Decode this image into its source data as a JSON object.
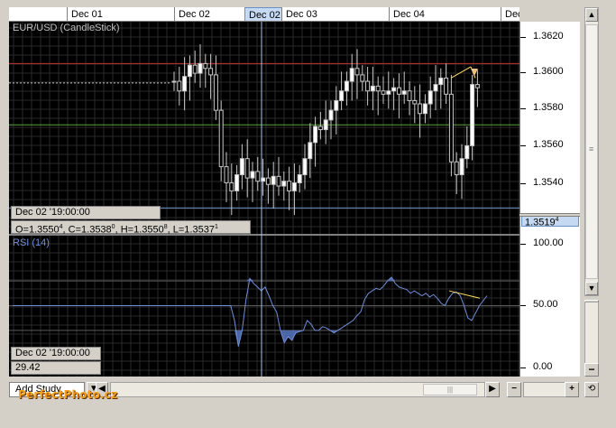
{
  "date_axis": {
    "labels": [
      {
        "text": "Dec 01",
        "selected": false
      },
      {
        "text": "Dec 02",
        "selected": false
      },
      {
        "text": "Dec 02",
        "selected": true
      },
      {
        "text": "Dec 03",
        "selected": false
      },
      {
        "text": "Dec 04",
        "selected": false
      },
      {
        "text": "Dec",
        "selected": false
      }
    ]
  },
  "price_pane": {
    "title": "EUR/USD (CandleStick)",
    "axis_labels": [
      "1.3620",
      "1.3600",
      "1.3580",
      "1.3560",
      "1.3540"
    ],
    "current_price": "1.3519",
    "current_price_sup": "4",
    "hover_time": "Dec 02 '19:00:00",
    "ohlc": {
      "o": "O=1.3550",
      "o_sup": "4",
      "c": "C=1.3538",
      "c_sup": "0",
      "h": "H=1.3550",
      "h_sup": "8",
      "l": "L=1.3537",
      "l_sup": "1"
    }
  },
  "rsi_pane": {
    "title": "RSI (14)",
    "axis_labels": [
      "100.00",
      "50.00",
      "0.00"
    ],
    "hover_time": "Dec 02 '19:00:00",
    "value": "29.42"
  },
  "bottom_bar": {
    "add_study_label": "Add Study",
    "zoom_minus": "−",
    "zoom_plus": "+",
    "refresh": "⟲"
  },
  "watermark": "PerfectPhoto.cz",
  "colors": {
    "chart_bg": "#000000",
    "grid": "#2a2a2a",
    "candle": "#c8c8c8",
    "resistance": "#c03030",
    "support": "#5aa03a",
    "rsi_line": "#6f8fdc",
    "crosshair": "#a0c8f0",
    "trendline": "#ffe060"
  },
  "chart_data": [
    {
      "type": "candlestick",
      "title": "EUR/USD (CandleStick)",
      "ylim": [
        1.3505,
        1.3635
      ],
      "ticks": [
        1.362,
        1.36,
        1.358,
        1.356,
        1.354
      ],
      "levels": {
        "resistance": 1.3609,
        "support": 1.3571,
        "current": 1.35194
      },
      "close_path": [
        1.3598,
        1.3592,
        1.3601,
        1.3608,
        1.3603,
        1.3609,
        1.3606,
        1.3602,
        1.358,
        1.3545,
        1.3535,
        1.353,
        1.354,
        1.355,
        1.3538,
        1.3542,
        1.3536,
        1.3538,
        1.3534,
        1.3539,
        1.3533,
        1.3536,
        1.353,
        1.3535,
        1.354,
        1.355,
        1.356,
        1.357,
        1.3568,
        1.3574,
        1.358,
        1.3586,
        1.3592,
        1.3598,
        1.3606,
        1.3602,
        1.3598,
        1.3592,
        1.3595,
        1.3592,
        1.359,
        1.3592,
        1.3594,
        1.359,
        1.3592,
        1.3586,
        1.3584,
        1.3578,
        1.3584,
        1.3592,
        1.3596,
        1.36,
        1.359,
        1.3548,
        1.354,
        1.355,
        1.3558,
        1.3596,
        1.3594
      ]
    },
    {
      "type": "line",
      "title": "RSI (14)",
      "ylim": [
        0,
        100
      ],
      "ticks": [
        100,
        50,
        0
      ],
      "values": [
        50,
        50,
        50,
        50,
        50,
        50,
        50,
        50,
        50,
        50,
        50,
        50,
        50,
        50,
        50,
        50,
        50,
        50,
        50,
        50,
        50,
        50,
        50,
        50,
        50,
        50,
        50,
        50,
        50,
        50,
        50,
        50,
        50,
        50,
        50,
        50,
        50,
        50,
        50,
        50,
        50,
        50,
        50,
        50,
        50,
        50,
        50,
        50,
        50,
        50,
        50,
        50,
        50,
        50,
        50,
        50,
        50,
        50,
        38,
        17,
        30,
        55,
        72,
        68,
        65,
        62,
        65,
        58,
        50,
        45,
        30,
        20,
        25,
        22,
        28,
        29,
        30,
        38,
        35,
        30,
        30,
        33,
        32,
        30,
        28,
        30,
        32,
        34,
        36,
        38,
        42,
        45,
        55,
        60,
        62,
        64,
        63,
        66,
        70,
        73,
        68,
        65,
        64,
        63,
        60,
        62,
        60,
        58,
        60,
        57,
        59,
        56,
        52,
        50,
        56,
        60,
        61,
        58,
        50,
        40,
        38,
        44,
        50,
        54,
        58
      ]
    }
  ]
}
